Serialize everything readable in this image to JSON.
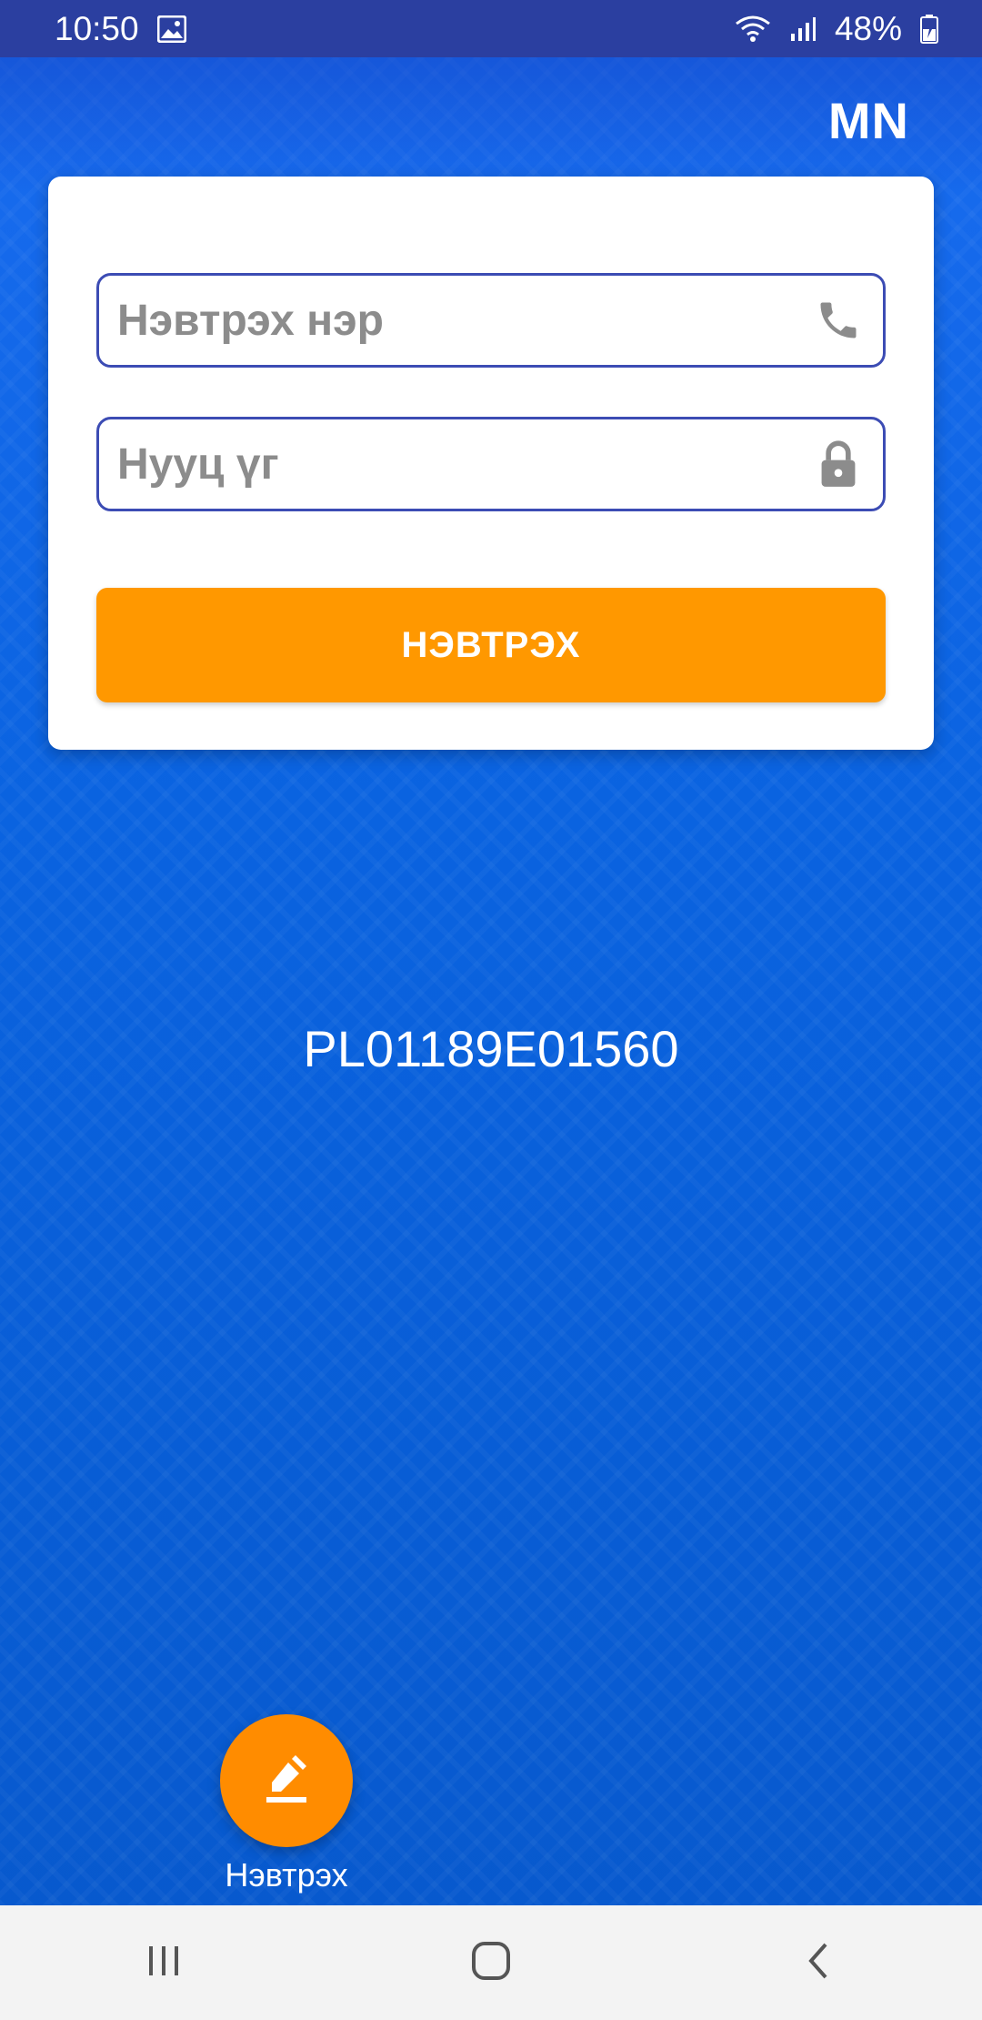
{
  "status_bar": {
    "time": "10:50",
    "battery": "48%",
    "icons": [
      "gallery-icon",
      "wifi-icon",
      "signal-icon",
      "battery-icon"
    ]
  },
  "header": {
    "language": "MN"
  },
  "login_form": {
    "username_placeholder": "Нэвтрэх нэр",
    "username_icon": "phone-icon",
    "password_placeholder": "Нууц үг",
    "password_icon": "lock-icon",
    "submit_label": "НЭВТРЭХ"
  },
  "device": {
    "serial": "PL01189E01560"
  },
  "fab": {
    "icon": "edit-icon",
    "label": "Нэвтрэх"
  },
  "navigation": {
    "buttons": [
      "recent-apps-icon",
      "home-icon",
      "back-icon"
    ]
  },
  "colors": {
    "status_bar": "#2b3fa0",
    "background": "#0a63e0",
    "accent": "#ff9800",
    "field_border": "#3c4cb4"
  }
}
